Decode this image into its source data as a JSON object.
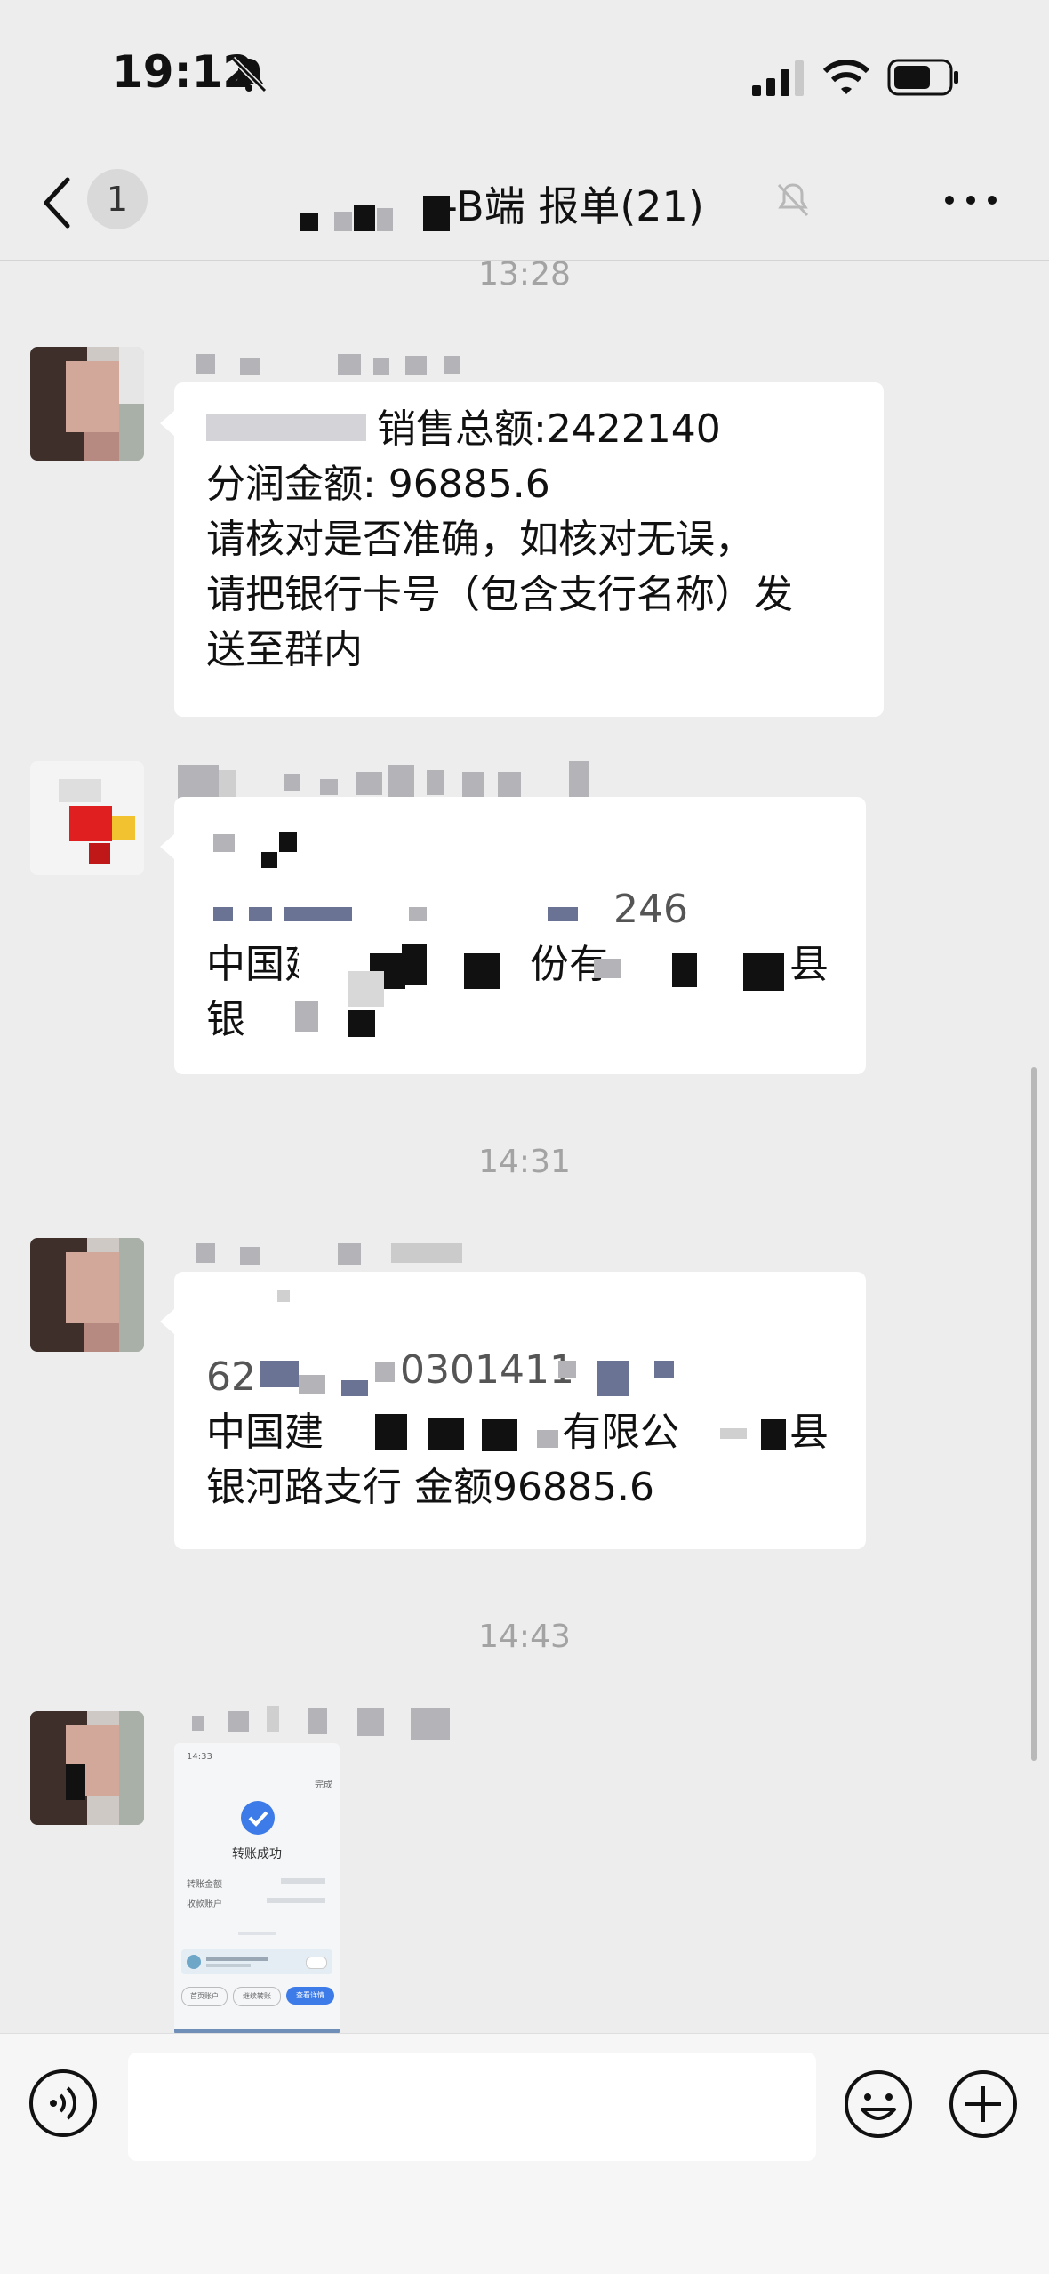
{
  "status_bar": {
    "time": "19:12",
    "icons": [
      "bell-off-icon",
      "signal-icon",
      "wifi-icon",
      "battery-icon"
    ]
  },
  "nav": {
    "unread_count": "1",
    "title": "-B端 报单(21)",
    "icons": [
      "back-chevron-icon",
      "mute-bell-icon",
      "more-icon"
    ]
  },
  "messages": {
    "ts1": "13:28",
    "msg1": {
      "line1": "销售总额:2422140",
      "line2": "分润金额:  96885.6",
      "line3": "请核对是否准确，如核对无误，",
      "line4": "请把银行卡号（包含支行名称）发",
      "line5": "送至群内"
    },
    "msg2": {
      "line2": "246",
      "line3a": "中国建设",
      "line3b": "份有",
      "line3c": "县",
      "line4": "银"
    },
    "ts2": "14:31",
    "msg3": {
      "line1a": "62",
      "line1b": "0301411",
      "line2a": "中国建",
      "line2b": "有限公",
      "line2c": "县",
      "line3": "银河路支行 金额96885.6"
    },
    "ts3": "14:43",
    "image_msg": {
      "time": "14:33",
      "done": "完成",
      "title": "转账成功",
      "row1_label": "转账金额",
      "row2_label": "收款账户",
      "btn1": "首页账户",
      "btn2": "继续转账",
      "btn3": "查看详情"
    }
  },
  "input_bar": {
    "placeholder": "",
    "icons": [
      "voice-icon",
      "emoji-icon",
      "plus-icon"
    ]
  },
  "colors": {
    "background": "#ededed",
    "bubble": "#ffffff",
    "timestamp": "#a3a3a3",
    "accent_blue": "#3d7be8"
  }
}
